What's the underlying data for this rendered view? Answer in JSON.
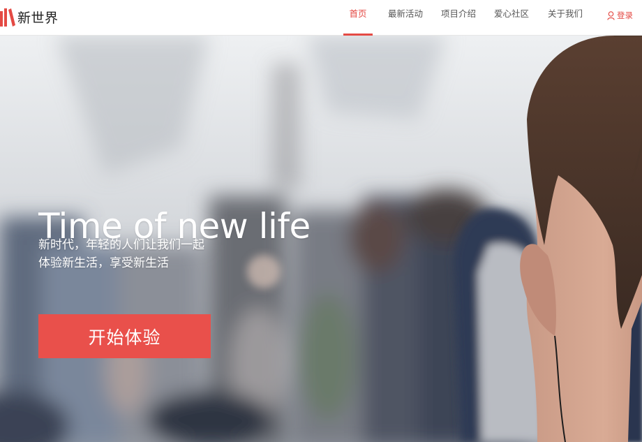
{
  "brand": {
    "name": "新世界",
    "logo_icon": "books-logo-icon",
    "accent_color": "#e44a44"
  },
  "nav": {
    "items": [
      {
        "label": "首页",
        "active": true
      },
      {
        "label": "最新活动",
        "active": false
      },
      {
        "label": "项目介绍",
        "active": false
      },
      {
        "label": "爱心社区",
        "active": false
      },
      {
        "label": "关于我们",
        "active": false
      }
    ],
    "login_label": "登录",
    "login_icon": "user-icon"
  },
  "hero": {
    "title": "Time of new life",
    "subtitle_line1": "新时代，年轻的人们让我们一起",
    "subtitle_line2": "体验新生活，享受新生活",
    "cta_label": "开始体验",
    "cta_color": "#e9504b",
    "background": "blurred airplane cabin photo"
  }
}
